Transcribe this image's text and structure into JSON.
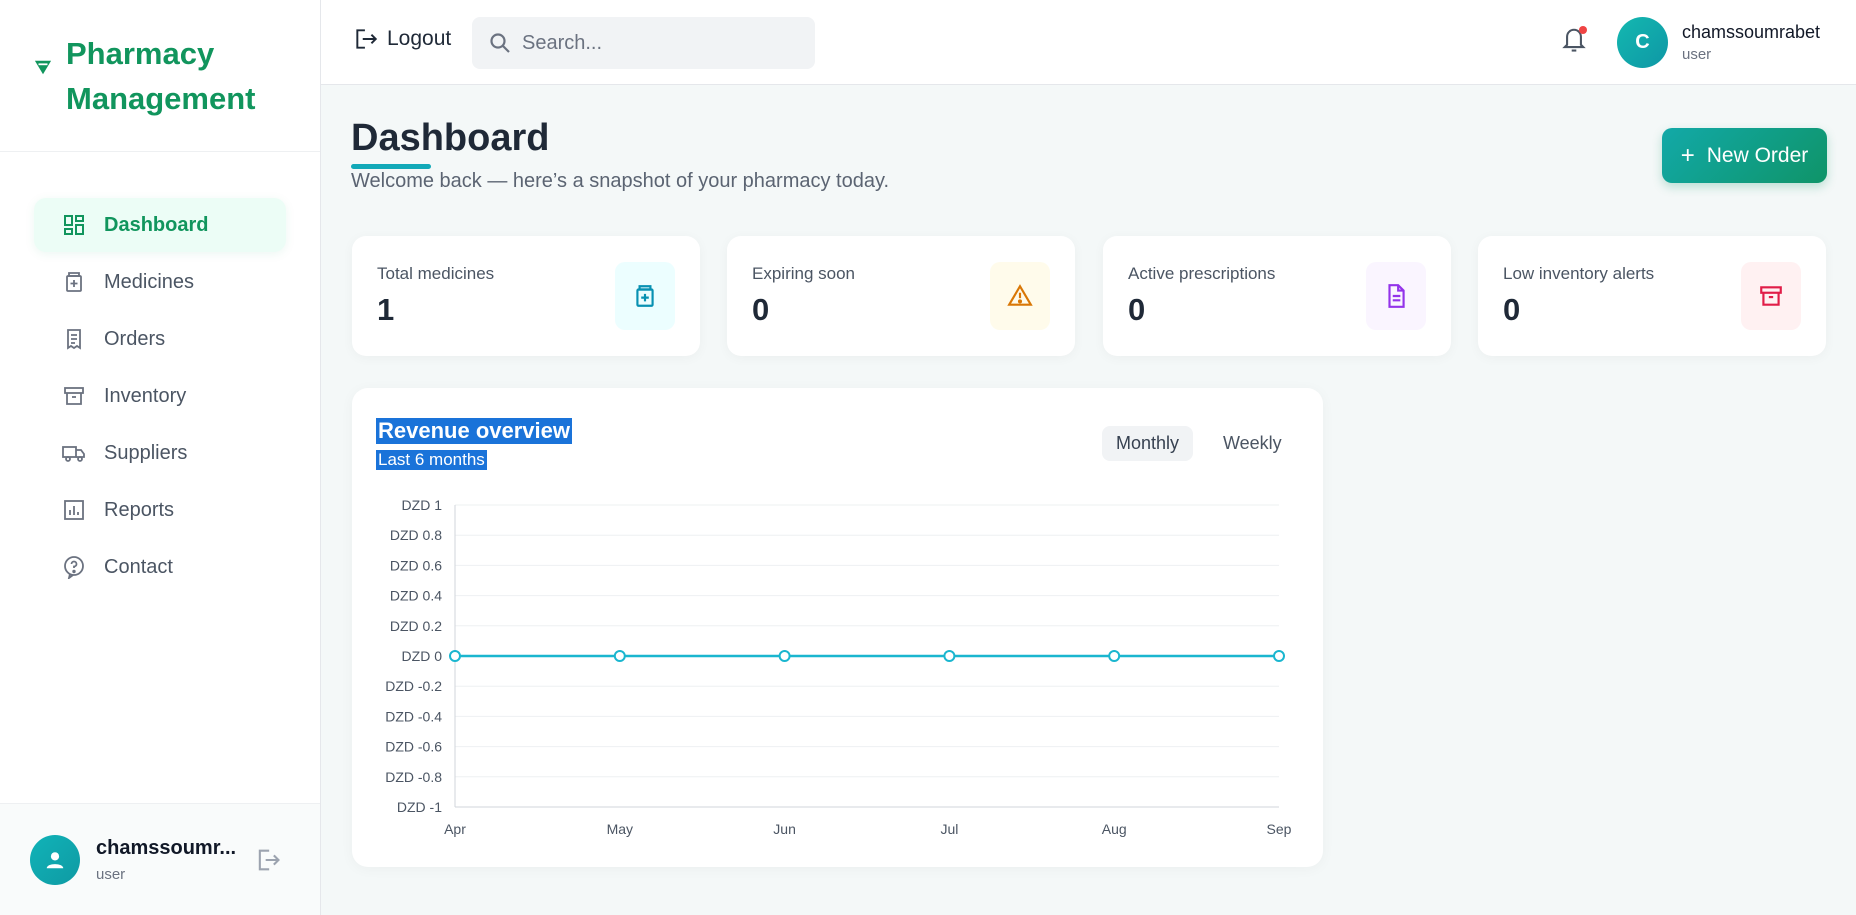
{
  "brand": {
    "name_line1": "Pharmacy",
    "name_line2": "Management",
    "color": "#11955d"
  },
  "nav": [
    {
      "label": "Dashboard",
      "icon": "dashboard-icon",
      "active": true
    },
    {
      "label": "Medicines",
      "icon": "medicine-icon",
      "active": false
    },
    {
      "label": "Orders",
      "icon": "receipt-icon",
      "active": false
    },
    {
      "label": "Inventory",
      "icon": "archive-icon",
      "active": false
    },
    {
      "label": "Suppliers",
      "icon": "truck-icon",
      "active": false
    },
    {
      "label": "Reports",
      "icon": "bar-chart-icon",
      "active": false
    },
    {
      "label": "Contact",
      "icon": "help-icon",
      "active": false
    }
  ],
  "sidebar_user": {
    "name": "chamssoumr...",
    "role": "user"
  },
  "header": {
    "logout_label": "Logout",
    "search_placeholder": "Search...",
    "avatar_initial": "C",
    "user_name": "chamssoumrabet",
    "user_role": "user"
  },
  "page": {
    "title": "Dashboard",
    "subtitle": "Welcome back — here’s a snapshot of your pharmacy today.",
    "new_order_label": "New Order"
  },
  "stats": [
    {
      "label": "Total medicines",
      "value": "1",
      "icon": "medicine-box-icon",
      "color": "#0891b2",
      "bg": "#ecfeff"
    },
    {
      "label": "Expiring soon",
      "value": "0",
      "icon": "warning-icon",
      "color": "#d97706",
      "bg": "#fffbeb"
    },
    {
      "label": "Active prescriptions",
      "value": "0",
      "icon": "document-icon",
      "color": "#9333ea",
      "bg": "#faf5ff"
    },
    {
      "label": "Low inventory alerts",
      "value": "0",
      "icon": "archive-box-icon",
      "color": "#e11d48",
      "bg": "#fff1f2"
    }
  ],
  "revenue": {
    "title": "Revenue overview",
    "subtitle": "Last 6 months",
    "toggle_monthly": "Monthly",
    "toggle_weekly": "Weekly"
  },
  "chart_data": {
    "type": "line",
    "title": "Revenue overview",
    "subtitle": "Last 6 months",
    "categories": [
      "Apr",
      "May",
      "Jun",
      "Jul",
      "Aug",
      "Sep"
    ],
    "series": [
      {
        "values": [
          0,
          0,
          0,
          0,
          0,
          0
        ]
      }
    ],
    "ylim": [
      -1,
      1
    ],
    "yticks": [
      "DZD 1",
      "DZD 0.8",
      "DZD 0.6",
      "DZD 0.4",
      "DZD 0.2",
      "DZD 0",
      "DZD -0.2",
      "DZD -0.4",
      "DZD -0.6",
      "DZD -0.8",
      "DZD -1"
    ],
    "ytick_values": [
      1,
      0.8,
      0.6,
      0.4,
      0.2,
      0,
      -0.2,
      -0.4,
      -0.6,
      -0.8,
      -1
    ],
    "grid": true,
    "line_color": "#1ab6cf"
  }
}
